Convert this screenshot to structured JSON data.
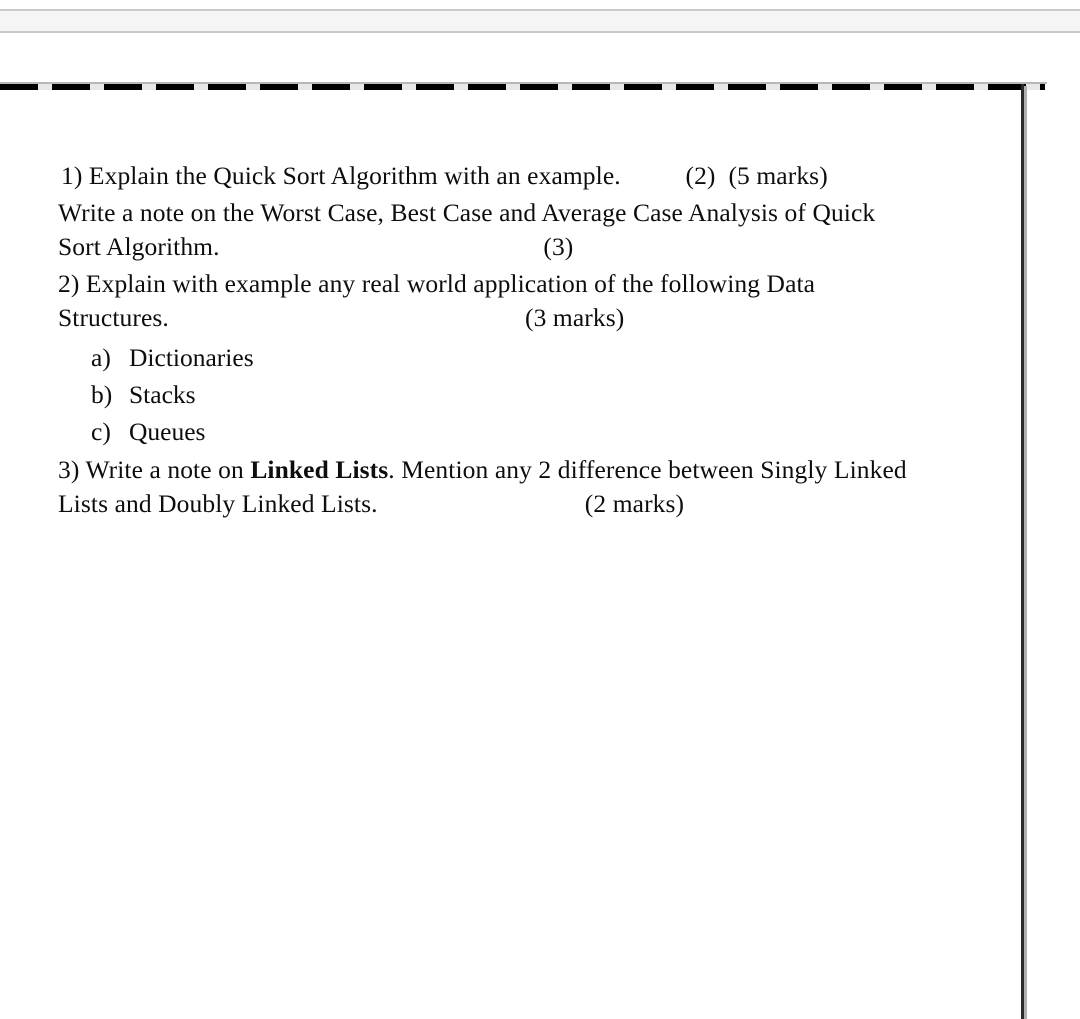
{
  "window": {
    "toolbar_visible": true
  },
  "document": {
    "questions": [
      {
        "id": "q1",
        "line1": "1) Explain the Quick Sort Algorithm with an example.          (2)  (5 marks)",
        "line2_pre": "Write a note on the Worst Case, Best Case and Average Case Analysis of Quick",
        "line3": "Sort Algorithm.                                                  (3)"
      },
      {
        "id": "q2",
        "line1": "2) Explain with example any real world application of the following Data",
        "line2": "Structures.                                                       (3 marks)",
        "items": [
          {
            "marker": "a)",
            "label": "Dictionaries"
          },
          {
            "marker": "b)",
            "label": "Stacks"
          },
          {
            "marker": "c)",
            "label": "Queues"
          }
        ]
      },
      {
        "id": "q3",
        "line1_a": "3) Write a note on ",
        "line1_bold": "Linked Lists",
        "line1_b": ". Mention any 2 difference between Singly Linked",
        "line2": "Lists and Doubly Linked Lists.                                (2 marks)"
      }
    ]
  },
  "colors": {
    "page_background": "#ffffff",
    "text": "#0d0d0d",
    "toolbar_fill": "#f5f5f5",
    "toolbar_border": "#c9c9c9",
    "page_border_dark": "#2b2b2b",
    "page_border_light": "#b0b0b0"
  }
}
